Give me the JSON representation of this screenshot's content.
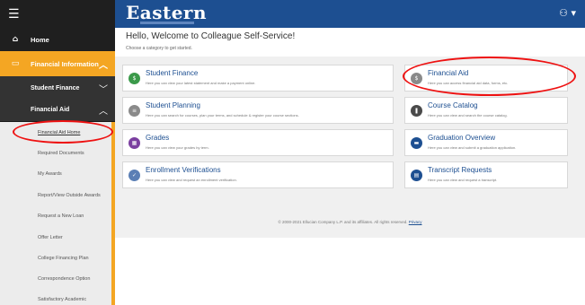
{
  "header": {
    "logo_text": "Eastern",
    "user_icon": "user-icon"
  },
  "sidebar": {
    "menu_icon": "☰",
    "home": {
      "label": "Home",
      "icon": "home-icon"
    },
    "financial_information": {
      "label": "Financial Information",
      "icon": "money-icon"
    },
    "student_finance": {
      "label": "Student Finance"
    },
    "financial_aid": {
      "label": "Financial Aid"
    },
    "links": [
      {
        "label": "Financial Aid Home",
        "active": true
      },
      {
        "label": "Required Documents"
      },
      {
        "label": "My Awards"
      },
      {
        "label": "Report/View Outside Awards"
      },
      {
        "label": "Request a New Loan"
      },
      {
        "label": "Offer Letter"
      },
      {
        "label": "College Financing Plan"
      },
      {
        "label": "Correspondence Option"
      },
      {
        "label": "Satisfactory Academic"
      }
    ]
  },
  "main": {
    "welcome": "Hello, Welcome to Colleague Self-Service!",
    "choose": "Choose a category to get started.",
    "cards": [
      {
        "title": "Student Finance",
        "desc": "Here you can view your latest statement and make a payment online.",
        "color": "#3b9a4a",
        "icon": "$"
      },
      {
        "title": "Financial Aid",
        "desc": "Here you can access financial aid data, forms, etc.",
        "color": "#8a8a8a",
        "icon": "$"
      },
      {
        "title": "Student Planning",
        "desc": "Here you can search for courses, plan your terms, and schedule & register your course sections.",
        "color": "#8a8a8a",
        "icon": "≡"
      },
      {
        "title": "Course Catalog",
        "desc": "Here you can view and search the course catalog.",
        "color": "#4a4a4a",
        "icon": "❚"
      },
      {
        "title": "Grades",
        "desc": "Here you can view your grades by term.",
        "color": "#7b3fa0",
        "icon": "▦"
      },
      {
        "title": "Graduation Overview",
        "desc": "Here you can view and submit a graduation application.",
        "color": "#1d4f91",
        "icon": "▬"
      },
      {
        "title": "Enrollment Verifications",
        "desc": "Here you can view and request an enrollment verification.",
        "color": "#5b7fb5",
        "icon": "✓"
      },
      {
        "title": "Transcript Requests",
        "desc": "Here you can view and request a transcript.",
        "color": "#1d4f91",
        "icon": "▤"
      }
    ],
    "footer": "© 2000-2021 Ellucian Company L.P. and its affiliates. All rights reserved.",
    "privacy": "Privacy"
  }
}
